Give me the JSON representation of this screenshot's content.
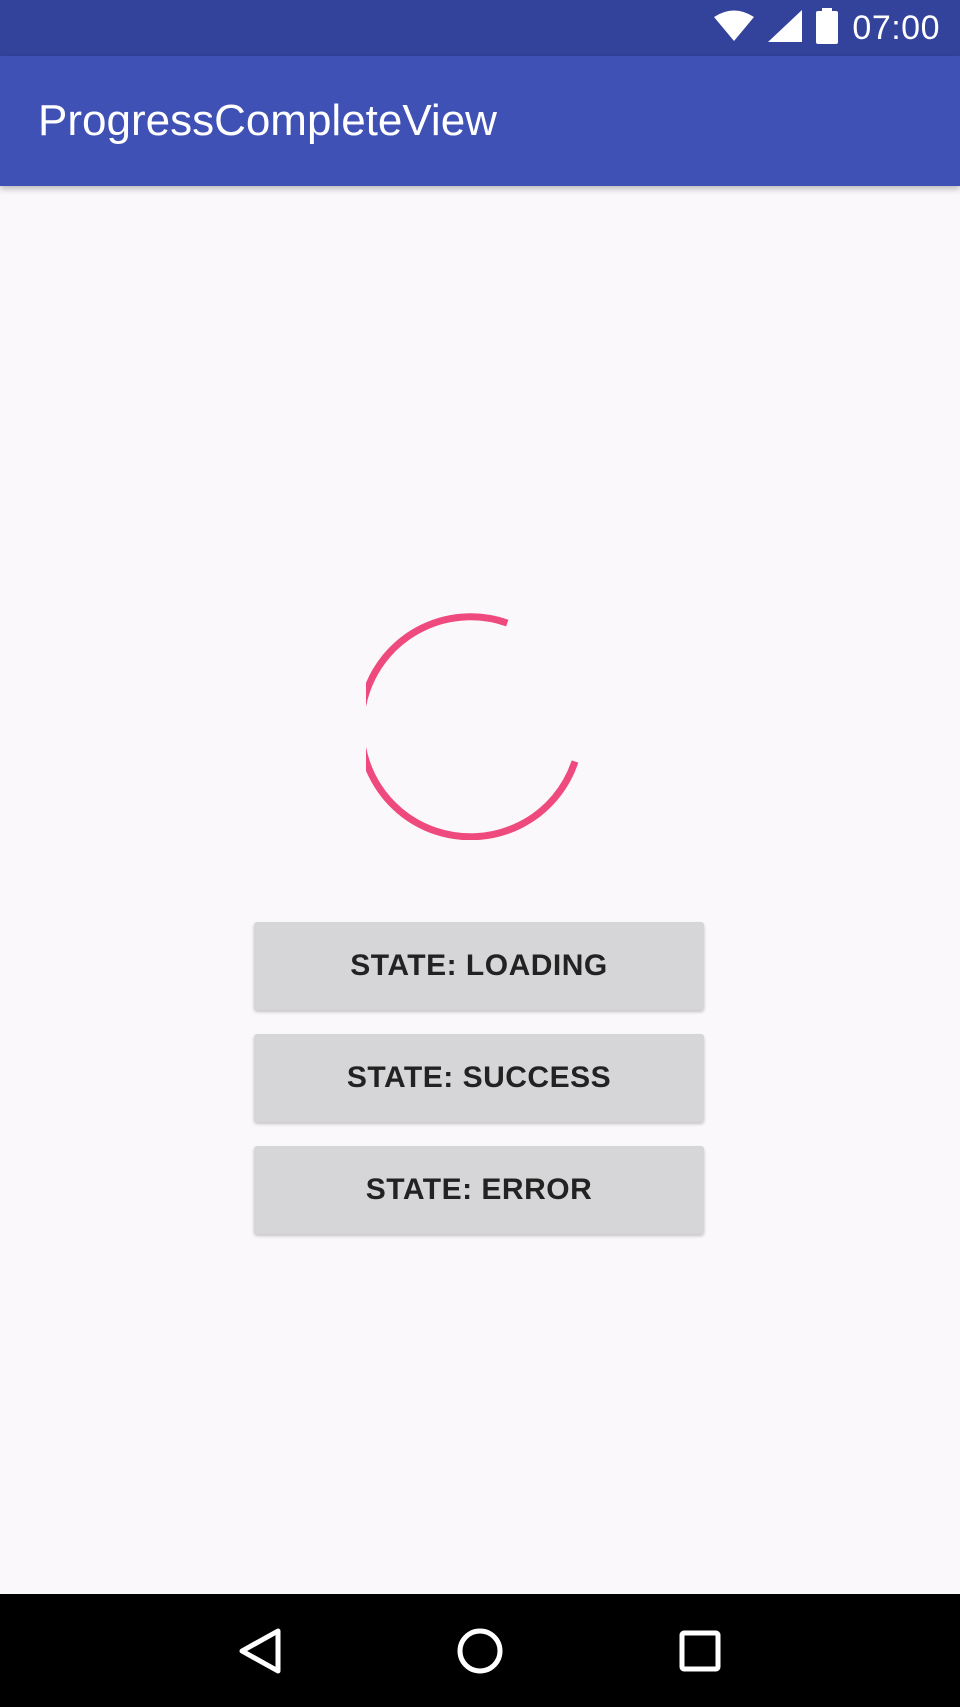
{
  "status_bar": {
    "time": "07:00",
    "icons": [
      "wifi-icon",
      "cell-signal-icon",
      "battery-icon"
    ]
  },
  "app_bar": {
    "title": "ProgressCompleteView",
    "color": "#3f51b5",
    "status_color": "#33429b"
  },
  "progress": {
    "state": "loading",
    "color": "#ef4a7e"
  },
  "buttons": [
    {
      "label": "STATE: LOADING"
    },
    {
      "label": "STATE: SUCCESS"
    },
    {
      "label": "STATE: ERROR"
    }
  ],
  "nav_bar": {
    "icons": [
      "back-icon",
      "home-icon",
      "recents-icon"
    ]
  }
}
